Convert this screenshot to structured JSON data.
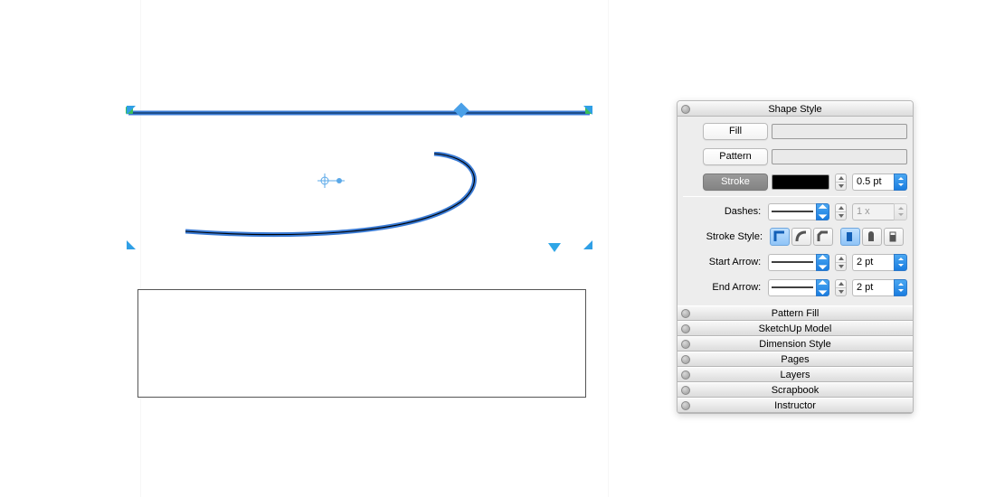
{
  "panel": {
    "sections": {
      "shape_style": "Shape Style",
      "pattern_fill": "Pattern Fill",
      "sketchup_model": "SketchUp Model",
      "dimension_style": "Dimension Style",
      "pages": "Pages",
      "layers": "Layers",
      "scrapbook": "Scrapbook",
      "instructor": "Instructor"
    },
    "shape_style": {
      "fill_label": "Fill",
      "pattern_label": "Pattern",
      "stroke_label": "Stroke",
      "stroke_width": "0.5 pt",
      "dashes_label": "Dashes:",
      "dashes_multiplier": "1 x",
      "stroke_style_label": "Stroke Style:",
      "start_arrow_label": "Start Arrow:",
      "start_arrow_size": "2 pt",
      "end_arrow_label": "End Arrow:",
      "end_arrow_size": "2 pt"
    }
  }
}
